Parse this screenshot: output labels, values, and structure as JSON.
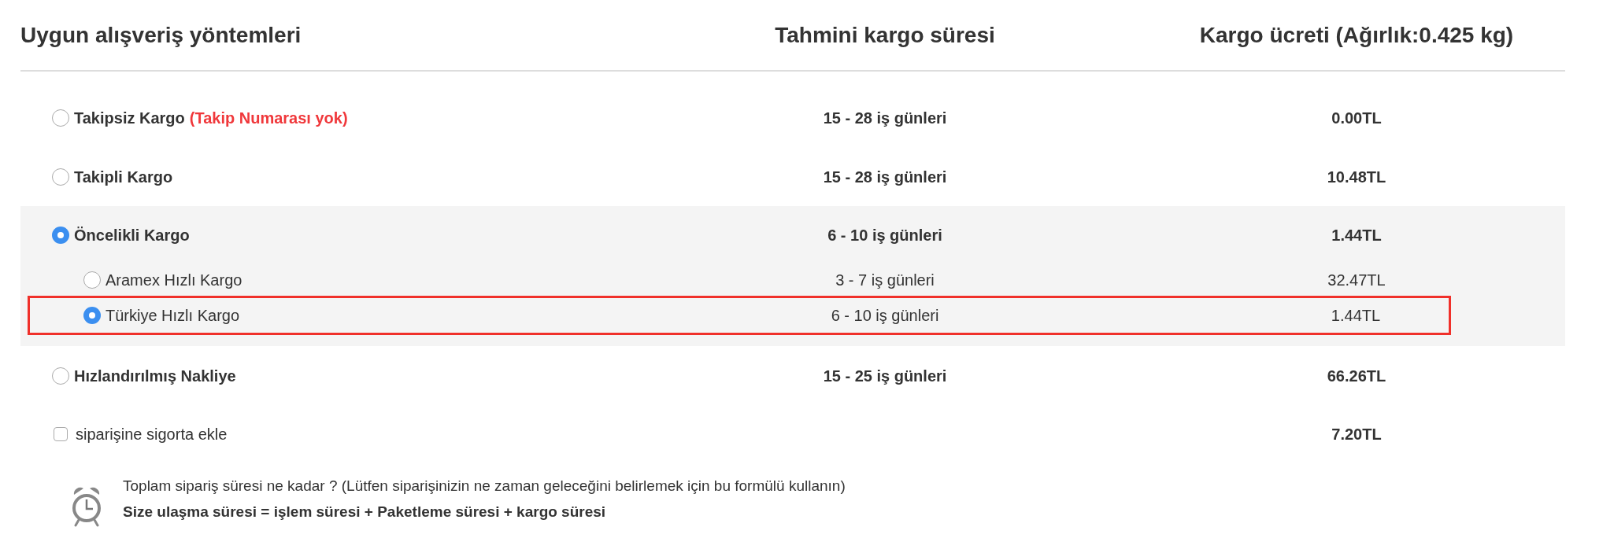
{
  "headers": [
    "Uygun alışveriş yöntemleri",
    "Tahmini kargo süresi",
    "Kargo ücreti (Ağırlık:0.425 kg)"
  ],
  "methods": [
    {
      "label": "Takipsiz Kargo",
      "note": "(Takip Numarası yok)",
      "time": "15 - 28 iş günleri",
      "price": "0.00TL",
      "selected": false
    },
    {
      "label": "Takipli Kargo",
      "time": "15 - 28 iş günleri",
      "price": "10.48TL",
      "selected": false
    },
    {
      "label": "Öncelikli Kargo",
      "time": "6 - 10 iş günleri",
      "price": "1.44TL",
      "selected": true,
      "children": [
        {
          "label": "Aramex Hızlı Kargo",
          "time": "3 - 7 iş günleri",
          "price": "32.47TL",
          "selected": false,
          "highlighted": false
        },
        {
          "label": "Türkiye Hızlı Kargo",
          "time": "6 - 10 iş günleri",
          "price": "1.44TL",
          "selected": true,
          "highlighted": true
        }
      ]
    },
    {
      "label": "Hızlandırılmış Nakliye",
      "time": "15 - 25 iş günleri",
      "price": "66.26TL",
      "selected": false
    }
  ],
  "insurance": {
    "label": "siparişine sigorta ekle",
    "price": "7.20TL",
    "checked": false
  },
  "info": {
    "question": "Toplam sipariş süresi ne kadar ? (Lütfen siparişinizin ne zaman geleceğini belirlemek için bu formülü kullanın)",
    "formula": "Size ulaşma süresi = işlem süresi + Paketleme süresi + kargo süresi"
  }
}
